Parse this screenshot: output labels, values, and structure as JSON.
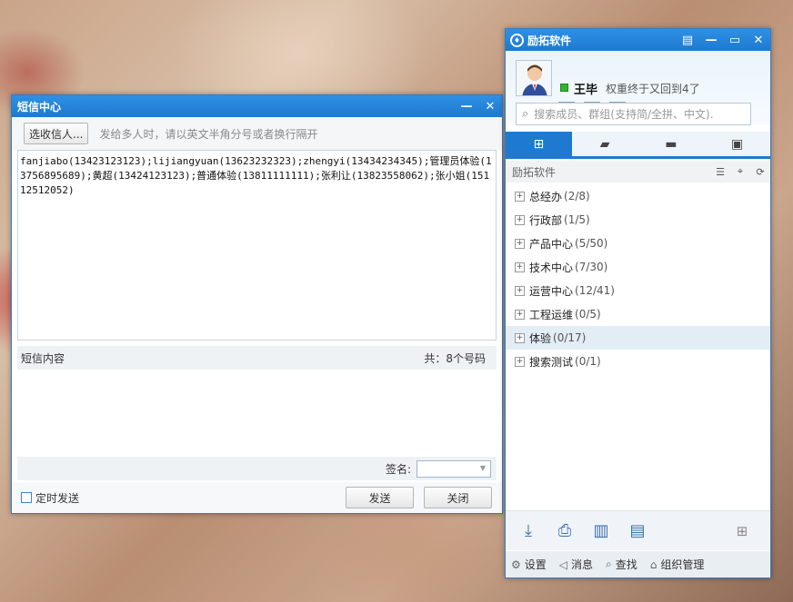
{
  "sms": {
    "title": "短信中心",
    "pick_button": "选收信人...",
    "hint": "发给多人时，请以英文半角分号或者换行隔开",
    "recipients": "fanjiabo(13423123123);lijiangyuan(13623232323);zhengyi(13434234345);管理员体验(13756895689);黄超(13424123123);普通体验(13811111111);张利让(13823558062);张小姐(15112512052)",
    "content_label": "短信内容",
    "count_label": "共：8个号码",
    "signature_label": "签名:",
    "timer_label": "定时发送",
    "send_button": "发送",
    "close_button": "关闭"
  },
  "main": {
    "title": "励拓软件",
    "user_name": "王毕",
    "user_signature": "权重终于又回到4了",
    "search_placeholder": "搜索成员、群组(支持简/全拼、中文).",
    "group_header": "励拓软件",
    "tree": [
      {
        "name": "总经办",
        "count": "(2/8)"
      },
      {
        "name": "行政部",
        "count": "(1/5)"
      },
      {
        "name": "产品中心",
        "count": "(5/50)"
      },
      {
        "name": "技术中心",
        "count": "(7/30)"
      },
      {
        "name": "运营中心",
        "count": "(12/41)"
      },
      {
        "name": "工程运维",
        "count": "(0/5)"
      },
      {
        "name": "体验",
        "count": "(0/17)"
      },
      {
        "name": "搜索测试",
        "count": "(0/1)"
      }
    ],
    "footer": {
      "settings": "设置",
      "messages": "消息",
      "find": "查找",
      "org": "组织管理"
    }
  },
  "colors": {
    "titlebar": "#1d7ad0",
    "online": "#35b035"
  }
}
